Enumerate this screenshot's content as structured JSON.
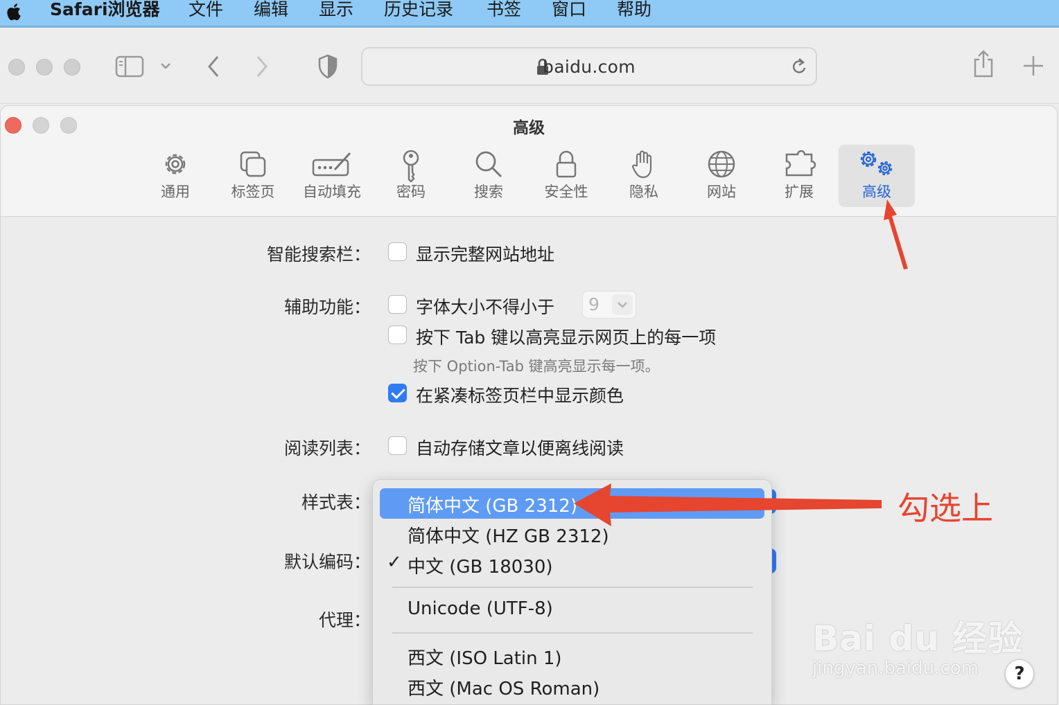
{
  "menubar": {
    "app_name": "Safari浏览器",
    "items": [
      "文件",
      "编辑",
      "显示",
      "历史记录",
      "书签",
      "窗口",
      "帮助"
    ]
  },
  "toolbar": {
    "url": "baidu.com",
    "icons": [
      "sidebar-icon",
      "chevron-down-icon",
      "back-icon",
      "forward-icon",
      "privacy-shield-icon",
      "lock-icon",
      "reload-icon",
      "share-icon",
      "new-tab-plus-icon"
    ]
  },
  "prefs": {
    "title": "高级",
    "tabs": [
      {
        "label": "通用",
        "icon": "gear-icon"
      },
      {
        "label": "标签页",
        "icon": "tabs-icon"
      },
      {
        "label": "自动填充",
        "icon": "autofill-icon"
      },
      {
        "label": "密码",
        "icon": "key-icon"
      },
      {
        "label": "搜索",
        "icon": "search-icon"
      },
      {
        "label": "安全性",
        "icon": "lock-icon"
      },
      {
        "label": "隐私",
        "icon": "hand-icon"
      },
      {
        "label": "网站",
        "icon": "globe-icon"
      },
      {
        "label": "扩展",
        "icon": "puzzle-icon"
      },
      {
        "label": "高级",
        "icon": "gears-icon",
        "active": true
      }
    ],
    "smart_search": {
      "label": "智能搜索栏：",
      "show_full_address": "显示完整网站地址"
    },
    "accessibility": {
      "label": "辅助功能：",
      "min_font_size": "字体大小不得小于",
      "min_font_value": "9",
      "tab_highlight": "按下 Tab 键以高亮显示网页上的每一项",
      "tab_hint": "按下 Option-Tab 键高亮显示每一项。",
      "compact_color": "在紧凑标签页栏中显示颜色"
    },
    "reading_list": {
      "label": "阅读列表：",
      "save_offline": "自动存储文章以便离线阅读"
    },
    "stylesheet_label": "样式表：",
    "default_encoding_label": "默认编码：",
    "proxy_label": "代理："
  },
  "dropdown": {
    "items": [
      {
        "label": "简体中文 (GB 2312)",
        "highlighted": true
      },
      {
        "label": "简体中文 (HZ GB 2312)"
      },
      {
        "label": "中文 (GB 18030)",
        "checked": true
      },
      {
        "label": "Unicode (UTF-8)"
      },
      {
        "label": "西文 (ISO Latin 1)"
      },
      {
        "label": "西文 (Mac OS Roman)"
      }
    ],
    "checkmark": "✓"
  },
  "annotation": {
    "text": "勾选上",
    "color": "#e6452f"
  },
  "watermark": {
    "brand": "Bai du 经验",
    "url": "jingyan.baidu.com"
  },
  "help_button": "?",
  "colors": {
    "accent": "#2f7bf5",
    "highlight": "#5f9bf4",
    "close": "#ed6a5e",
    "menubar": "#8fc9f5"
  }
}
